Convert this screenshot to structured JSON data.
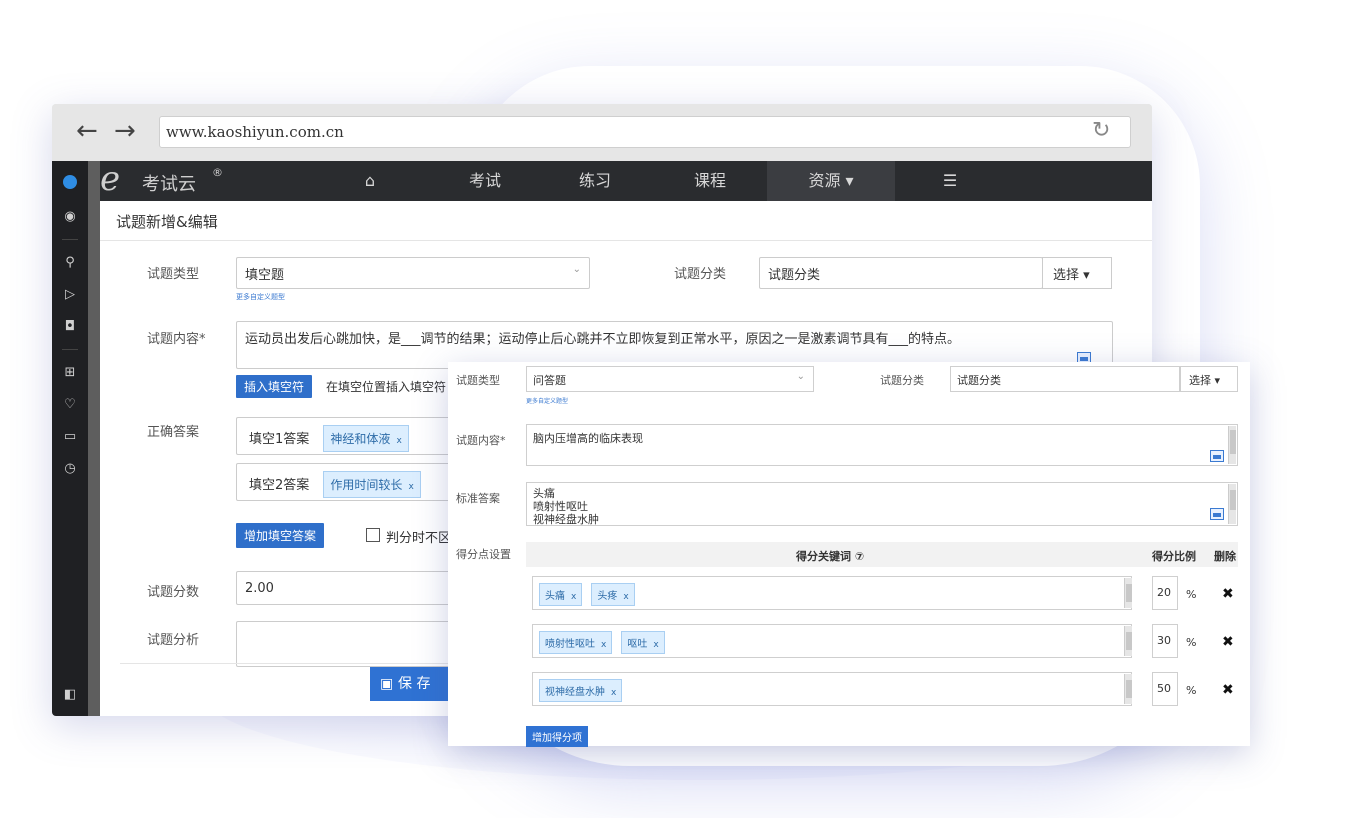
{
  "browser": {
    "url": "www.kaoshiyun.com.cn"
  },
  "app": {
    "brand": "考试云",
    "registered": "®",
    "logo_letter": "e",
    "nav": [
      {
        "label": "考试"
      },
      {
        "label": "练习"
      },
      {
        "label": "课程"
      },
      {
        "label": "资源 ▾"
      }
    ]
  },
  "icons": {
    "home": "home-icon",
    "list": "list-icon",
    "back": "arrow-left-icon",
    "forward": "arrow-right-icon",
    "reload": "reload-icon"
  },
  "editor": {
    "page_title": "试题新增&编辑",
    "type_label": "试题类型",
    "type_value": "填空题",
    "type_link": "更多自定义题型",
    "category_label": "试题分类",
    "category_value": "试题分类",
    "select_label": "选择 ▾",
    "content_label": "试题内容*",
    "content_value": "运动员出发后心跳加快，是___调节的结果；运动停止后心跳并不立即恢复到正常水平，原因之一是激素调节具有___的特点。",
    "insert_blank_btn": "插入填空符",
    "insert_blank_hint": "在填空位置插入填空符",
    "answer_label": "正确答案",
    "answers": [
      {
        "label": "填空1答案",
        "tags": [
          "神经和体液"
        ]
      },
      {
        "label": "填空2答案",
        "tags": [
          "作用时间较长"
        ]
      }
    ],
    "add_answer_btn": "增加填空答案",
    "checkbox_label": "判分时不区",
    "score_label": "试题分数",
    "score_value": "2.00",
    "analysis_label": "试题分析",
    "save_label": "保 存"
  },
  "card": {
    "type_label": "试题类型",
    "type_value": "问答题",
    "type_link": "更多自定义题型",
    "category_label": "试题分类",
    "category_value": "试题分类",
    "select_label": "选择 ▾",
    "content_label": "试题内容*",
    "content_value": "脑内压增高的临床表现",
    "standard_label": "标准答案",
    "standard_lines": [
      "头痛",
      "喷射性呕吐",
      "视神经盘水肿"
    ],
    "score_setting_label": "得分点设置",
    "col_keyword": "得分关键词 ⑦",
    "col_ratio": "得分比例",
    "col_delete": "删除",
    "rows": [
      {
        "tags": [
          "头痛",
          "头疼"
        ],
        "ratio": "20"
      },
      {
        "tags": [
          "喷射性呕吐",
          "呕吐"
        ],
        "ratio": "30"
      },
      {
        "tags": [
          "视神经盘水肿"
        ],
        "ratio": "50"
      }
    ],
    "percent_sign": "%",
    "add_score_btn": "增加得分项"
  }
}
